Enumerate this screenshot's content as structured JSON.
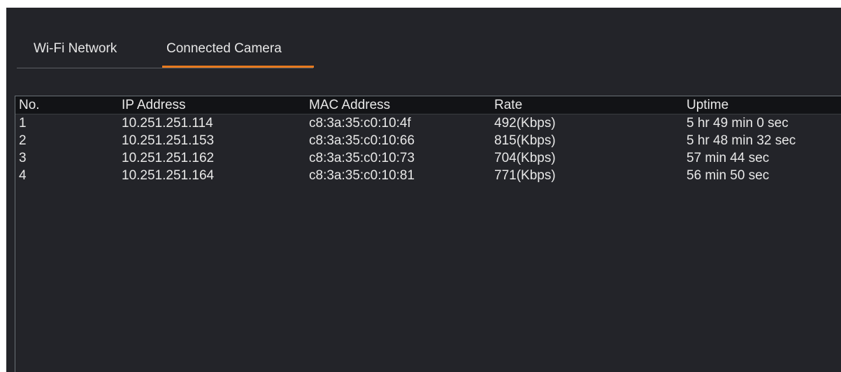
{
  "tabs": [
    {
      "label": "Wi-Fi Network",
      "active": false
    },
    {
      "label": "Connected Camera",
      "active": true
    }
  ],
  "accent_color": "#e87a1e",
  "table": {
    "headers": {
      "no": "No.",
      "ip": "IP Address",
      "mac": "MAC Address",
      "rate": "Rate",
      "uptime": "Uptime"
    },
    "rows": [
      {
        "no": "1",
        "ip": "10.251.251.114",
        "mac": "c8:3a:35:c0:10:4f",
        "rate": "492(Kbps)",
        "uptime": "5 hr 49 min 0 sec"
      },
      {
        "no": "2",
        "ip": "10.251.251.153",
        "mac": "c8:3a:35:c0:10:66",
        "rate": "815(Kbps)",
        "uptime": "5 hr 48 min 32 sec"
      },
      {
        "no": "3",
        "ip": "10.251.251.162",
        "mac": "c8:3a:35:c0:10:73",
        "rate": "704(Kbps)",
        "uptime": "57 min 44 sec"
      },
      {
        "no": "4",
        "ip": "10.251.251.164",
        "mac": "c8:3a:35:c0:10:81",
        "rate": "771(Kbps)",
        "uptime": "56 min 50 sec"
      }
    ]
  }
}
